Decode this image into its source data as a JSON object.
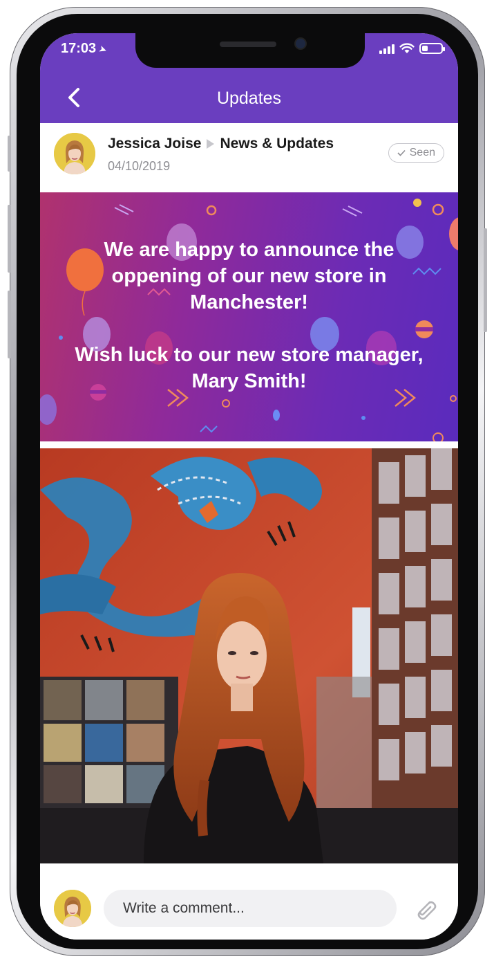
{
  "status_bar": {
    "time": "17:03",
    "battery_level": 0.3
  },
  "header": {
    "title": "Updates"
  },
  "post": {
    "author": "Jessica Joise",
    "channel": "News & Updates",
    "date": "04/10/2019",
    "seen_label": "Seen",
    "announcement": {
      "line1": "We are happy to announce the oppening of our new store in Manchester!",
      "line2": "Wish luck to our new store manager, Mary Smith!"
    }
  },
  "comment": {
    "placeholder": "Write a comment..."
  },
  "colors": {
    "header_bg": "#6a3ebf",
    "banner_start": "#b0326e",
    "banner_end": "#5a2bbd",
    "photo_wall": "#c24a2c",
    "subtle_text": "#8e8e93"
  },
  "icons": {
    "back": "chevron-left-icon",
    "location": "location-arrow-icon",
    "signal": "signal-icon",
    "wifi": "wifi-icon",
    "battery": "battery-icon",
    "separator": "triangle-right-icon",
    "seen": "check-icon",
    "attach": "paperclip-icon"
  }
}
